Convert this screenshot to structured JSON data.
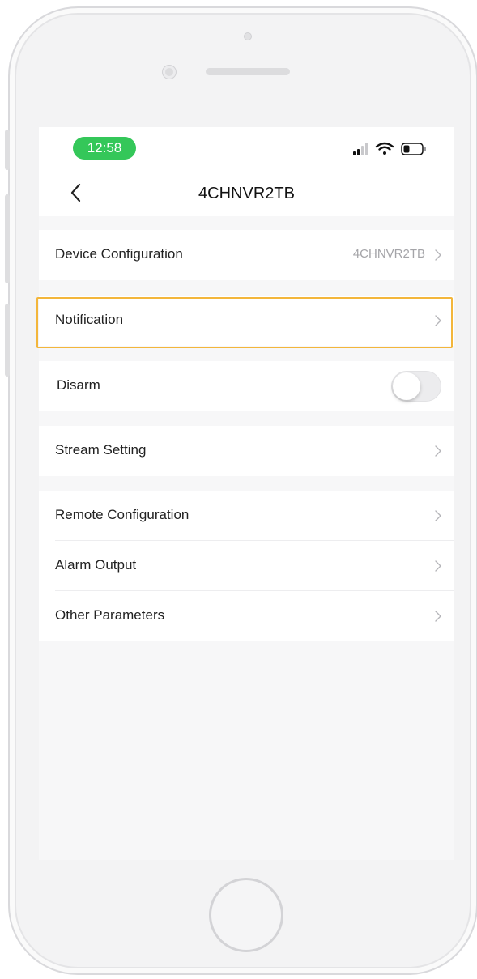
{
  "status_bar": {
    "time": "12:58",
    "time_pill_color": "#34c759",
    "icons": [
      "signal-icon",
      "wifi-icon",
      "battery-icon"
    ]
  },
  "nav": {
    "title": "4CHNVR2TB",
    "back_icon": "chevron-left-icon"
  },
  "settings": {
    "device_configuration": {
      "label": "Device Configuration",
      "value": "4CHNVR2TB"
    },
    "notification": {
      "label": "Notification"
    },
    "disarm": {
      "label": "Disarm",
      "toggle_on": false
    },
    "stream_setting": {
      "label": "Stream Setting"
    },
    "remote_configuration": {
      "label": "Remote Configuration"
    },
    "alarm_output": {
      "label": "Alarm Output"
    },
    "other_parameters": {
      "label": "Other Parameters"
    }
  },
  "colors": {
    "highlight": "#f3b63b",
    "background": "#f7f7f8",
    "row": "#ffffff"
  }
}
